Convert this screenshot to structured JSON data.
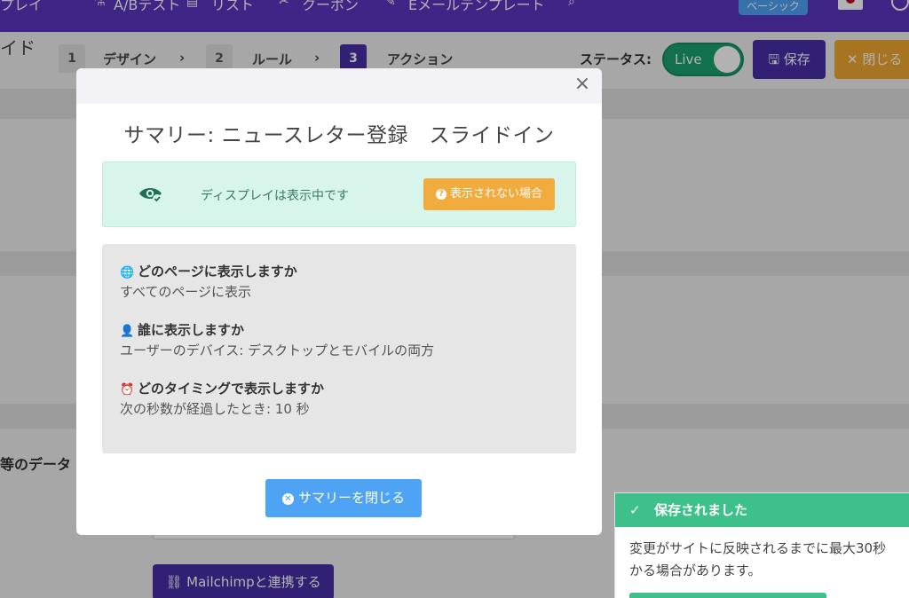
{
  "topnav": {
    "items": [
      {
        "label": "プレイ"
      },
      {
        "label": "A/Bテスト"
      },
      {
        "label": "リスト"
      },
      {
        "label": "クーポン"
      },
      {
        "label": "Eメールテンプレート"
      }
    ],
    "plan_badge": "ベーシック"
  },
  "page": {
    "title_fragment": "イド"
  },
  "steps": [
    {
      "num": "1",
      "label": "デザイン"
    },
    {
      "num": "2",
      "label": "ルール"
    },
    {
      "num": "3",
      "label": "アクション"
    }
  ],
  "step_separator": "›",
  "status": {
    "label": "ステータス:",
    "toggle_text": "Live"
  },
  "toolbar": {
    "save_label": "保存",
    "close_label": "閉じる"
  },
  "background": {
    "data_text": "等のデータ",
    "mailchimp_label": "Mailchimpと連携する"
  },
  "modal": {
    "close_glyph": "×",
    "title": "サマリー: ニュースレター登録　スライドイン",
    "status_text": "ディスプレイは表示中です",
    "not_shown_label": "表示されない場合",
    "sections": [
      {
        "icon": "globe-icon",
        "heading": "どのページに表示しますか",
        "value": "すべてのページに表示"
      },
      {
        "icon": "user-icon",
        "heading": "誰に表示しますか",
        "value": "ユーザーのデバイス: デスクトップとモバイルの両方"
      },
      {
        "icon": "alarm-clock-icon",
        "heading": "どのタイミングで表示しますか",
        "value": "次の秒数が経過したとき: 10 秒"
      }
    ],
    "close_summary_label": "サマリーを閉じる"
  },
  "toast": {
    "title": "保存されました",
    "body_line1": "変更がサイトに反映されるまでに最大30秒",
    "body_line2": "かる場合があります。"
  },
  "colors": {
    "nav_purple": "#5a35c0",
    "primary_purple": "#4a2fa8",
    "live_green": "#1aa36e",
    "warning_orange": "#f2ac3e",
    "info_blue": "#4fa3f5",
    "success_green": "#3ec08b",
    "status_bg": "#d7f5ea"
  }
}
